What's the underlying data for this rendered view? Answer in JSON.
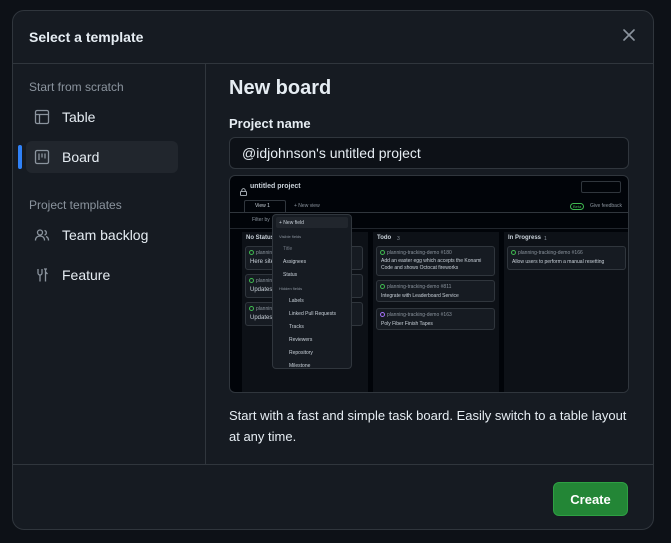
{
  "dialog": {
    "title": "Select a template"
  },
  "sidebar": {
    "scratch_heading": "Start from scratch",
    "scratch_items": [
      {
        "label": "Table",
        "icon": "table-icon"
      },
      {
        "label": "Board",
        "icon": "board-icon",
        "active": true
      }
    ],
    "templates_heading": "Project templates",
    "template_items": [
      {
        "label": "Team backlog",
        "icon": "people-icon"
      },
      {
        "label": "Feature",
        "icon": "tools-icon"
      }
    ]
  },
  "main": {
    "title": "New board",
    "name_label": "Project name",
    "name_value": "@idjohnson's untitled project",
    "description": "Start with a fast and simple task board. Easily switch to a table layout at any time."
  },
  "preview": {
    "project_title": "untitled project",
    "view_tab": "View 1",
    "new_view": "+ New view",
    "beta_badge": "Beta",
    "feedback": "Give feedback",
    "filter": "Filter by",
    "columns": [
      {
        "name": "No Status"
      },
      {
        "name": "Todo",
        "count": "3"
      },
      {
        "name": "In Progress",
        "count": "1"
      }
    ],
    "no_status_cards": [
      {
        "ref": "planning",
        "title": "Here site"
      },
      {
        "ref": "planning",
        "title": "Updates a"
      },
      {
        "ref": "planning",
        "title": "Updates a"
      }
    ],
    "todo_cards": [
      {
        "ref": "planning-tracking-demo #180",
        "title": "Add an easter egg which accepts the Konami Code and shows Octocat fireworks"
      },
      {
        "ref": "planning-tracking-demo #811",
        "title": "Integrate with Leaderboard Service"
      },
      {
        "ref": "planning-tracking-demo #163",
        "title": "Poly Fiber Finish Tapes"
      }
    ],
    "in_progress_cards": [
      {
        "ref": "planning-tracking-demo #166",
        "title": "Allow users to perform a manual resetting"
      }
    ],
    "menu": {
      "new_field": "+ New field",
      "visible_heading": "Visible fields",
      "visible_fields": [
        "Title",
        "Assignees",
        "Status"
      ],
      "hidden_heading": "Hidden fields",
      "hidden_fields": [
        "Labels",
        "Linked Pull Requests",
        "Tracks",
        "Reviewers",
        "Repository",
        "Milestone"
      ]
    }
  },
  "footer": {
    "create_label": "Create"
  },
  "colors": {
    "accent": "#2f81f7",
    "create_green": "#238636",
    "bg": "#161b22",
    "border": "#30363d"
  }
}
